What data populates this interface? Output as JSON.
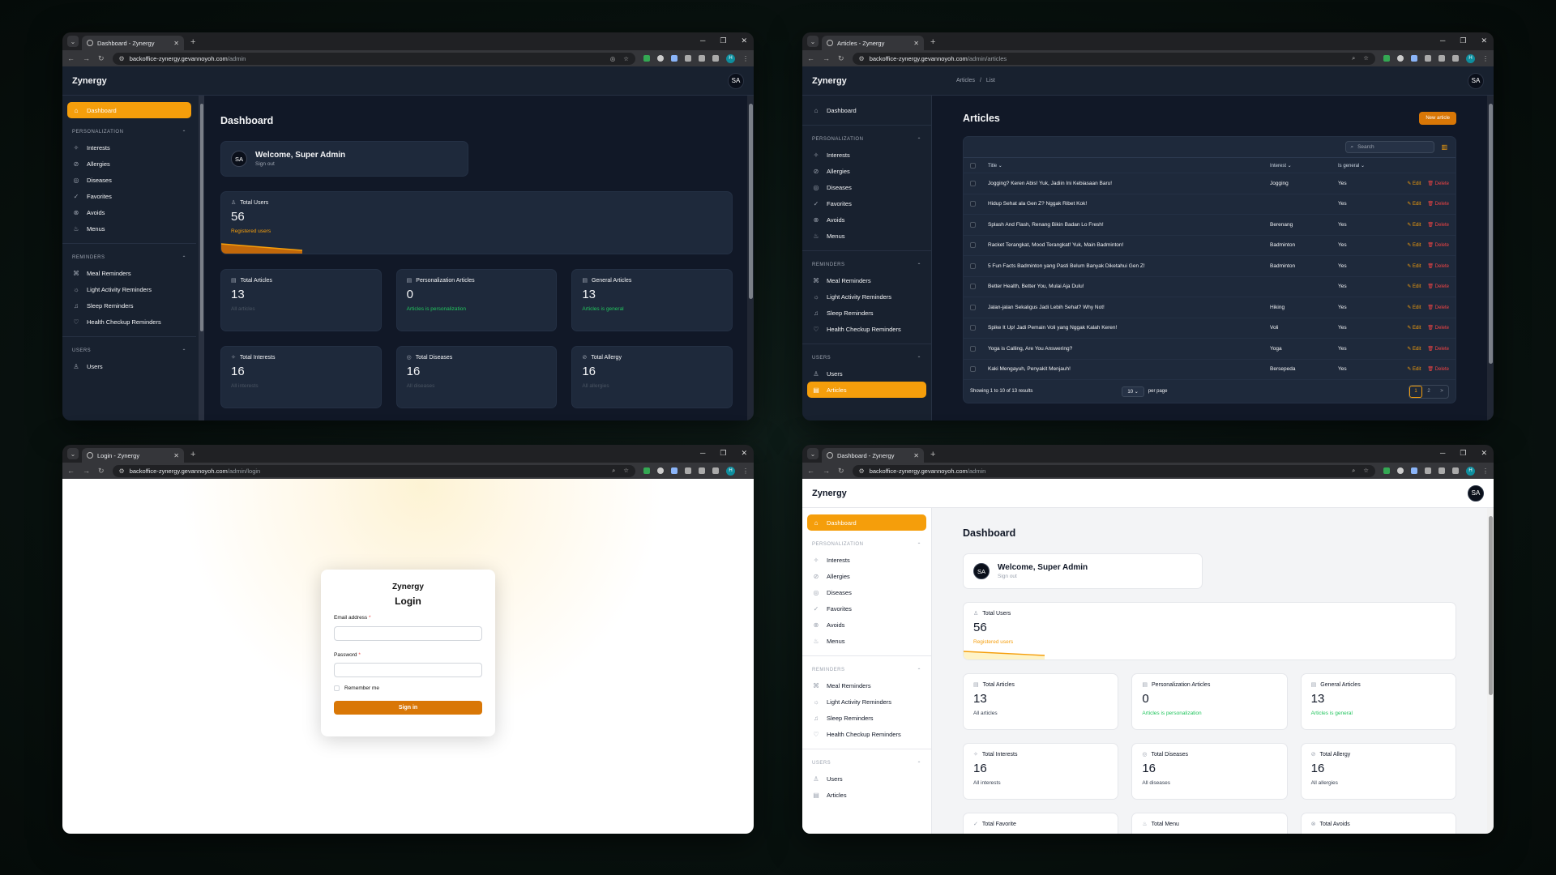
{
  "w1": {
    "tab_title": "Dashboard - Zynergy",
    "url_host": "backoffice-zynergy.gevannoyoh.com",
    "url_path": "/admin"
  },
  "w2": {
    "tab_title": "Articles - Zynergy",
    "url_host": "backoffice-zynergy.gevannoyoh.com",
    "url_path": "/admin/articles"
  },
  "w3": {
    "tab_title": "Login - Zynergy",
    "url_host": "backoffice-zynergy.gevannoyoh.com",
    "url_path": "/admin/login"
  },
  "w4": {
    "tab_title": "Dashboard - Zynergy",
    "url_host": "backoffice-zynergy.gevannoyoh.com",
    "url_path": "/admin"
  },
  "brand": "Zynergy",
  "user_initials": "SA",
  "nav": {
    "dashboard": "Dashboard",
    "group_personalization": "PERSONALIZATION",
    "interests": "Interests",
    "allergies": "Allergies",
    "diseases": "Diseases",
    "favorites": "Favorites",
    "avoids": "Avoids",
    "menus": "Menus",
    "group_reminders": "REMINDERS",
    "meal_reminders": "Meal Reminders",
    "light_activity_reminders": "Light Activity Reminders",
    "sleep_reminders": "Sleep Reminders",
    "health_checkup_reminders": "Health Checkup Reminders",
    "group_users": "USERS",
    "users": "Users",
    "articles": "Articles"
  },
  "dashboard": {
    "title": "Dashboard",
    "welcome": "Welcome, Super Admin",
    "sign_out": "Sign out",
    "total_users": {
      "label": "Total Users",
      "value": "56",
      "sub": "Registered users"
    },
    "total_articles": {
      "label": "Total Articles",
      "value": "13",
      "sub": "All articles"
    },
    "personalization_articles": {
      "label": "Personalization Articles",
      "value": "0",
      "sub": "Articles is personalization"
    },
    "general_articles": {
      "label": "General Articles",
      "value": "13",
      "sub": "Articles is general"
    },
    "total_interests": {
      "label": "Total Interests",
      "value": "16",
      "sub": "All interests"
    },
    "total_diseases": {
      "label": "Total Diseases",
      "value": "16",
      "sub": "All diseases"
    },
    "total_allergy": {
      "label": "Total Allergy",
      "value": "16",
      "sub": "All allergies"
    },
    "total_favorite": {
      "label": "Total Favorite"
    },
    "total_menu": {
      "label": "Total Menu"
    },
    "total_avoids": {
      "label": "Total Avoids"
    }
  },
  "articles": {
    "breadcrumb_1": "Articles",
    "breadcrumb_sep": "/",
    "breadcrumb_2": "List",
    "title": "Articles",
    "new_button": "New article",
    "search_placeholder": "Search",
    "col_title": "Title",
    "col_interest": "Interest",
    "col_general": "Is general",
    "edit": "Edit",
    "delete": "Delete",
    "rows": [
      {
        "title": "Jogging? Keren Abis! Yuk, Jadiin Ini Kebiasaan Baru!",
        "interest": "Jogging",
        "general": "Yes"
      },
      {
        "title": "Hidup Sehat ala Gen Z? Nggak Ribet Kok!",
        "interest": "",
        "general": "Yes"
      },
      {
        "title": "Splash And Flash, Renang Bikin Badan Lo Fresh!",
        "interest": "Berenang",
        "general": "Yes"
      },
      {
        "title": "Racket Terangkat, Mood Terangkat! Yuk, Main Badminton!",
        "interest": "Badminton",
        "general": "Yes"
      },
      {
        "title": "5 Fun Facts Badminton yang Pasti Belum Banyak Diketahui Gen Z!",
        "interest": "Badminton",
        "general": "Yes"
      },
      {
        "title": "Better Health, Better You, Mulai Aja Dulu!",
        "interest": "",
        "general": "Yes"
      },
      {
        "title": "Jalan-jalan Sekaligus Jadi Lebih Sehat? Why Not!",
        "interest": "Hiking",
        "general": "Yes"
      },
      {
        "title": "Spike It Up! Jadi Pemain Voli yang Nggak Kalah Keren!",
        "interest": "Voli",
        "general": "Yes"
      },
      {
        "title": "Yoga is Calling, Are You Answering?",
        "interest": "Yoga",
        "general": "Yes"
      },
      {
        "title": "Kaki Mengayuh, Penyakit Menjauh!",
        "interest": "Bersepeda",
        "general": "Yes"
      }
    ],
    "showing": "Showing 1 to 10 of 13 results",
    "per_page_value": "10",
    "per_page_label": "per page",
    "page_1": "1",
    "page_2": "2",
    "page_next": ">"
  },
  "login": {
    "brand": "Zynergy",
    "title": "Login",
    "email_label": "Email address",
    "password_label": "Password",
    "required_mark": "*",
    "remember": "Remember me",
    "submit": "Sign in"
  },
  "colors": {
    "accent": "#f59e0b",
    "accent_dark": "#d97706",
    "success": "#22c55e",
    "danger": "#ef4444"
  }
}
